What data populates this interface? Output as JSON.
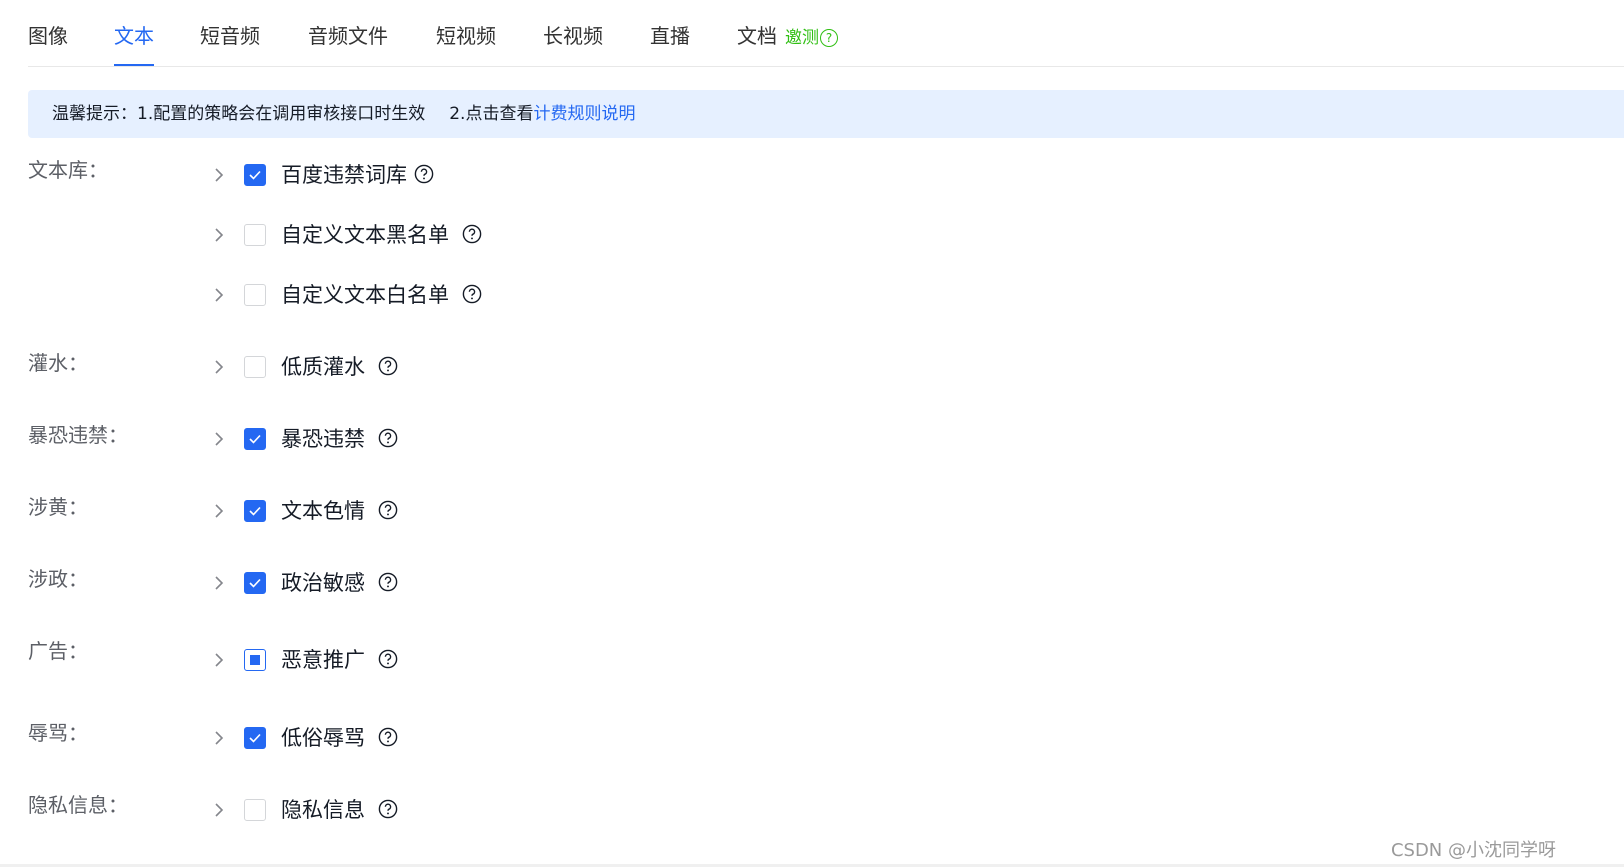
{
  "tabs": [
    {
      "label": "图像",
      "active": false
    },
    {
      "label": "文本",
      "active": true
    },
    {
      "label": "短音频",
      "active": false
    },
    {
      "label": "音频文件",
      "active": false
    },
    {
      "label": "短视频",
      "active": false
    },
    {
      "label": "长视频",
      "active": false
    },
    {
      "label": "直播",
      "active": false
    },
    {
      "label": "文档",
      "active": false,
      "badge": "邀测"
    }
  ],
  "notice": {
    "prefix": "温馨提示：1.配置的策略会在调用审核接口时生效",
    "part2": "2.点击查看",
    "link": "计费规则说明"
  },
  "groups": [
    {
      "label": "文本库：",
      "items": [
        {
          "label": "百度违禁词库",
          "state": "checked"
        },
        {
          "label": "自定义文本黑名单",
          "state": "unchecked"
        },
        {
          "label": "自定义文本白名单",
          "state": "unchecked"
        }
      ]
    },
    {
      "label": "灌水：",
      "items": [
        {
          "label": "低质灌水",
          "state": "unchecked"
        }
      ]
    },
    {
      "label": "暴恐违禁：",
      "items": [
        {
          "label": "暴恐违禁",
          "state": "checked"
        }
      ]
    },
    {
      "label": "涉黄：",
      "items": [
        {
          "label": "文本色情",
          "state": "checked"
        }
      ]
    },
    {
      "label": "涉政：",
      "items": [
        {
          "label": "政治敏感",
          "state": "checked"
        }
      ]
    },
    {
      "label": "广告：",
      "items": [
        {
          "label": "恶意推广",
          "state": "indeterminate"
        }
      ]
    },
    {
      "label": "辱骂：",
      "items": [
        {
          "label": "低俗辱骂",
          "state": "checked"
        }
      ]
    },
    {
      "label": "隐私信息：",
      "items": [
        {
          "label": "隐私信息",
          "state": "unchecked"
        }
      ]
    }
  ],
  "watermark": "CSDN @小沈同学呀",
  "colors": {
    "accent": "#2468f2",
    "notice_bg": "#e6f0ff",
    "beta_green": "#30bf13",
    "border": "#d4d6d9"
  },
  "icons": {
    "expand": "chevron-right-icon",
    "help": "question-circle-icon",
    "check": "check-icon"
  }
}
